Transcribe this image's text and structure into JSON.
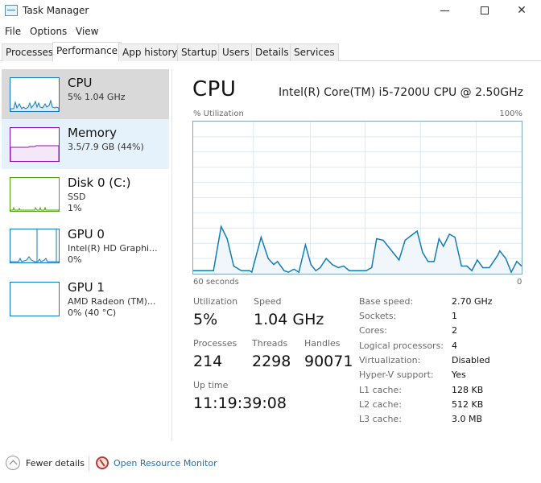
{
  "window": {
    "title": "Task Manager",
    "controls": {
      "minimize": "minimize",
      "maximize": "maximize",
      "close": "✕"
    }
  },
  "menu": [
    "File",
    "Options",
    "View"
  ],
  "tabs": [
    {
      "label": "Processes",
      "active": false
    },
    {
      "label": "Performance",
      "active": true
    },
    {
      "label": "App history",
      "active": false
    },
    {
      "label": "Startup",
      "active": false
    },
    {
      "label": "Users",
      "active": false
    },
    {
      "label": "Details",
      "active": false
    },
    {
      "label": "Services",
      "active": false
    }
  ],
  "sidebar": {
    "items": [
      {
        "title": "CPU",
        "sub": "5%  1.04 GHz",
        "sub2": "",
        "color": "#117dbb",
        "state": "selected"
      },
      {
        "title": "Memory",
        "sub": "3.5/7.9 GB (44%)",
        "sub2": "",
        "color": "#8b12ae",
        "state": "hover"
      },
      {
        "title": "Disk 0 (C:)",
        "sub": "SSD",
        "sub2": "1%",
        "color": "#4da60c",
        "state": ""
      },
      {
        "title": "GPU 0",
        "sub": "Intel(R) HD Graphi...",
        "sub2": "0%",
        "color": "#117dbb",
        "state": ""
      },
      {
        "title": "GPU 1",
        "sub": "AMD Radeon (TM)...",
        "sub2": "0%  (40 °C)",
        "color": "#117dbb",
        "state": ""
      }
    ]
  },
  "main": {
    "title": "CPU",
    "model": "Intel(R) Core(TM) i5-7200U CPU @ 2.50GHz",
    "graph": {
      "y_label": "% Utilization",
      "y_max_label": "100%",
      "x_left_label": "60 seconds",
      "x_right_label": "0"
    },
    "stats": {
      "utilization": {
        "label": "Utilization",
        "value": "5%"
      },
      "speed": {
        "label": "Speed",
        "value": "1.04 GHz"
      },
      "processes": {
        "label": "Processes",
        "value": "214"
      },
      "threads": {
        "label": "Threads",
        "value": "2298"
      },
      "handles": {
        "label": "Handles",
        "value": "90071"
      },
      "uptime": {
        "label": "Up time",
        "value": "11:19:39:08"
      }
    },
    "details": [
      {
        "label": "Base speed:",
        "value": "2.70 GHz"
      },
      {
        "label": "Sockets:",
        "value": "1"
      },
      {
        "label": "Cores:",
        "value": "2"
      },
      {
        "label": "Logical processors:",
        "value": "4"
      },
      {
        "label": "Virtualization:",
        "value": "Disabled"
      },
      {
        "label": "Hyper-V support:",
        "value": "Yes"
      },
      {
        "label": "L1 cache:",
        "value": "128 KB"
      },
      {
        "label": "L2 cache:",
        "value": "512 KB"
      },
      {
        "label": "L3 cache:",
        "value": "3.0 MB"
      }
    ]
  },
  "footer": {
    "fewer_details": "Fewer details",
    "resource_monitor": "Open Resource Monitor"
  },
  "chart_data": {
    "type": "area",
    "title": "CPU % Utilization",
    "xlabel": "60 seconds",
    "ylabel": "% Utilization",
    "xlim": [
      60,
      0
    ],
    "ylim": [
      0,
      100
    ],
    "grid": true,
    "line_color": "#117dbb",
    "fill_color": "#f1f6fa",
    "x_seconds_ago": [
      60,
      56.3,
      54.9,
      53.8,
      52.6,
      51.2,
      49.7,
      49.3,
      47.6,
      46.3,
      45.3,
      44.6,
      43.4,
      42.6,
      41.6,
      40.7,
      39.5,
      38.5,
      37.6,
      36.8,
      35.7,
      34.6,
      33.5,
      32.5,
      31.5,
      28.4,
      27.4,
      26.5,
      25.3,
      22.4,
      21.3,
      19.1,
      18.1,
      17.1,
      16.0,
      15.1,
      14.3,
      13.2,
      12.2,
      11.0,
      10.0,
      9.1,
      8.1,
      7.1,
      5.9,
      4.4,
      4.0,
      2.9,
      1.9,
      0.9,
      0
    ],
    "values": [
      2,
      2,
      31,
      23,
      5,
      2,
      2,
      1,
      24,
      10,
      6,
      8,
      2,
      1,
      3,
      1,
      19,
      6,
      2,
      4,
      10,
      6,
      4,
      5,
      2,
      2,
      4,
      23,
      22,
      9,
      22,
      28,
      14,
      8,
      8,
      23,
      18,
      26,
      24,
      5,
      5,
      2,
      9,
      4,
      4,
      12,
      15,
      10,
      1,
      8,
      5
    ]
  }
}
